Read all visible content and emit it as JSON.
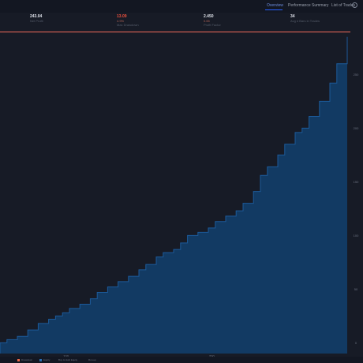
{
  "tabs": [
    {
      "label": "Overview",
      "active": true
    },
    {
      "label": "Performance Summary",
      "active": false
    },
    {
      "label": "List of Trades",
      "active": false
    }
  ],
  "stats": [
    {
      "value": "243.04",
      "pct": "",
      "label": "Net Profit",
      "red": false
    },
    {
      "value": "13.09",
      "pct": "4.9%",
      "label": "Max Drawdown",
      "red": true
    },
    {
      "value": "2.450",
      "pct": "0.65",
      "label": "Profit Factor",
      "red": false
    },
    {
      "value": "34",
      "pct": "",
      "label": "Avg # Bars in Trades",
      "red": false
    }
  ],
  "legend": [
    {
      "label": "Drawdown",
      "color": "#f06a4a"
    },
    {
      "label": "Equity",
      "color": "#2a6fb5"
    },
    {
      "label": "Buy & Hold Equity",
      "color": "#6c7280"
    },
    {
      "label": "Run-up",
      "color": "#6c7280"
    }
  ],
  "colors": {
    "background": "#171b26",
    "equity_fill": "#123a63",
    "equity_line": "#1c5a9a",
    "drawdown": "#f26a5a"
  },
  "chart_data": {
    "type": "area",
    "series": [
      {
        "name": "Equity",
        "x": [
          0,
          2,
          5,
          8,
          11,
          14,
          16,
          18,
          20,
          23,
          26,
          28,
          31,
          34,
          37,
          40,
          42,
          45,
          47,
          50,
          52,
          54,
          57,
          60,
          62,
          65,
          68,
          70,
          73,
          75,
          77,
          80,
          82,
          85,
          87,
          89,
          92,
          95,
          97,
          100
        ],
        "y": [
          0,
          3,
          6,
          12,
          18,
          22,
          25,
          28,
          32,
          36,
          41,
          47,
          52,
          57,
          62,
          68,
          73,
          80,
          84,
          87,
          93,
          100,
          103,
          107,
          113,
          118,
          123,
          130,
          141,
          156,
          164,
          175,
          185,
          196,
          200,
          211,
          225,
          242,
          260,
          285
        ]
      }
    ],
    "yticks": [
      "250",
      "200",
      "150",
      "100",
      "50",
      "0"
    ],
    "xticks": [
      "100",
      "200"
    ],
    "ylim": [
      -10,
      290
    ],
    "xlabel": "",
    "ylabel": "",
    "grid": false,
    "legend": "bottom-left"
  }
}
